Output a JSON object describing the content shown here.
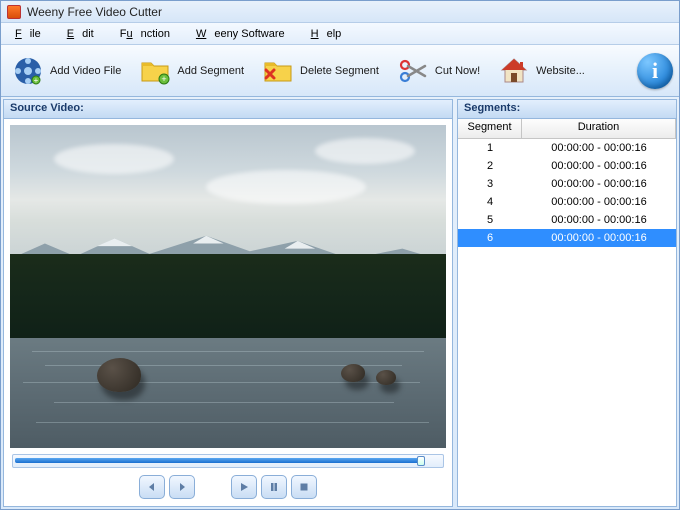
{
  "title": "Weeny Free Video Cutter",
  "menu": {
    "file": "File",
    "edit": "Edit",
    "function": "Function",
    "weeny": "Weeny Software",
    "help": "Help"
  },
  "toolbar": {
    "add_video": "Add Video File",
    "add_segment": "Add Segment",
    "delete_segment": "Delete Segment",
    "cut_now": "Cut Now!",
    "website": "Website..."
  },
  "panels": {
    "source": "Source Video:",
    "segments": "Segments:"
  },
  "segment_table": {
    "col_segment": "Segment",
    "col_duration": "Duration",
    "rows": [
      {
        "n": "1",
        "d": "00:00:00 - 00:00:16",
        "sel": false
      },
      {
        "n": "2",
        "d": "00:00:00 - 00:00:16",
        "sel": false
      },
      {
        "n": "3",
        "d": "00:00:00 - 00:00:16",
        "sel": false
      },
      {
        "n": "4",
        "d": "00:00:00 - 00:00:16",
        "sel": false
      },
      {
        "n": "5",
        "d": "00:00:00 - 00:00:16",
        "sel": false
      },
      {
        "n": "6",
        "d": "00:00:00 - 00:00:16",
        "sel": true
      }
    ]
  }
}
